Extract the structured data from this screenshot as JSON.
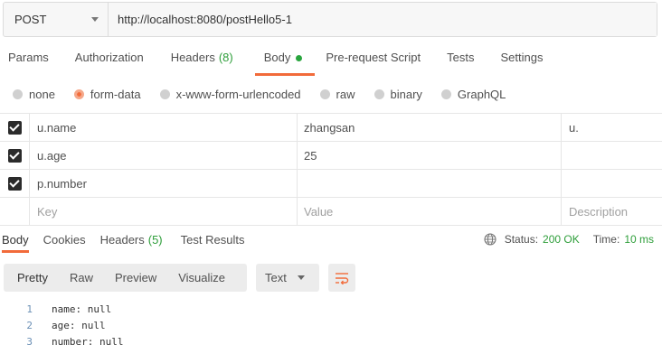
{
  "request": {
    "method": "POST",
    "url": "http://localhost:8080/postHello5-1"
  },
  "request_tabs": [
    {
      "label": "Params"
    },
    {
      "label": "Authorization"
    },
    {
      "label": "Headers",
      "count": "(8)"
    },
    {
      "label": "Body"
    },
    {
      "label": "Pre-request Script"
    },
    {
      "label": "Tests"
    },
    {
      "label": "Settings"
    }
  ],
  "body_types": [
    {
      "label": "none"
    },
    {
      "label": "form-data"
    },
    {
      "label": "x-www-form-urlencoded"
    },
    {
      "label": "raw"
    },
    {
      "label": "binary"
    },
    {
      "label": "GraphQL"
    }
  ],
  "params": {
    "rows": [
      {
        "key": "u.name",
        "value": "zhangsan",
        "description": "u."
      },
      {
        "key": "u.age",
        "value": "25",
        "description": ""
      },
      {
        "key": "p.number",
        "value": "",
        "description": ""
      }
    ],
    "placeholder": {
      "key": "Key",
      "value": "Value",
      "description": "Description"
    }
  },
  "response_tabs": [
    {
      "label": "Body"
    },
    {
      "label": "Cookies"
    },
    {
      "label": "Headers",
      "count": "(5)"
    },
    {
      "label": "Test Results"
    }
  ],
  "response_status": {
    "status_label": "Status:",
    "status_value": "200 OK",
    "time_label": "Time:",
    "time_value": "10 ms"
  },
  "view_modes": [
    "Pretty",
    "Raw",
    "Preview",
    "Visualize"
  ],
  "format": "Text",
  "code_lines": [
    {
      "num": "1",
      "text": "name: null"
    },
    {
      "num": "2",
      "text": "age: null"
    },
    {
      "num": "3",
      "text": "number: null"
    }
  ],
  "colors": {
    "accent": "#f26b3a",
    "status_green": "#2e9e3a"
  },
  "icons": [
    "chevron-down-icon",
    "checkbox-checked-icon",
    "globe-icon",
    "wrap-lines-icon"
  ]
}
